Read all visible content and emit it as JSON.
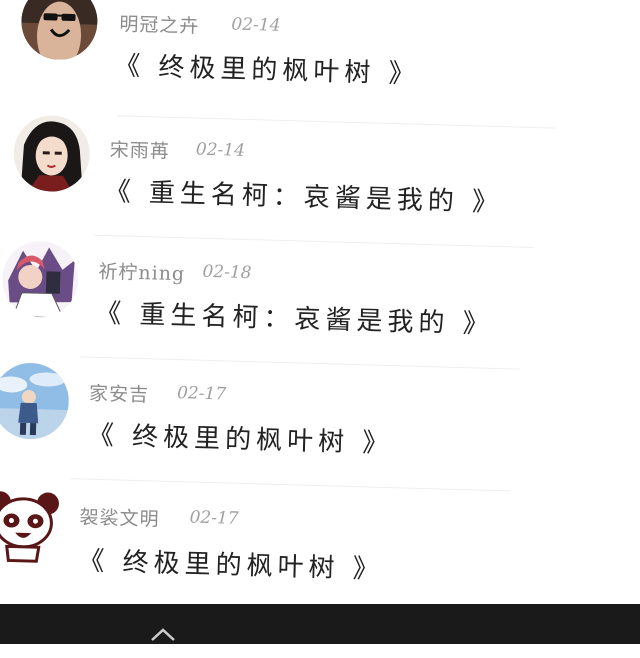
{
  "comments": [
    {
      "user": "明冠之卉",
      "date": "02-14",
      "title": "《 终极里的枫叶树 》",
      "avatar": "finger-face-avatar-icon"
    },
    {
      "user": "宋雨苒",
      "date": "02-14",
      "title": "《 重生名柯：哀酱是我的 》",
      "avatar": "anime-girl-avatar-icon"
    },
    {
      "user": "祈柠ning",
      "date": "02-18",
      "title": "《 重生名柯：哀酱是我的 》",
      "avatar": "anime-character-avatar-icon"
    },
    {
      "user": "家安吉",
      "date": "02-17",
      "title": "《 终极里的枫叶树 》",
      "avatar": "sky-scene-avatar-icon"
    },
    {
      "user": "袈裟文明",
      "date": "02-17",
      "title": "《 终极里的枫叶树 》",
      "avatar": "panda-avatar-icon"
    }
  ]
}
